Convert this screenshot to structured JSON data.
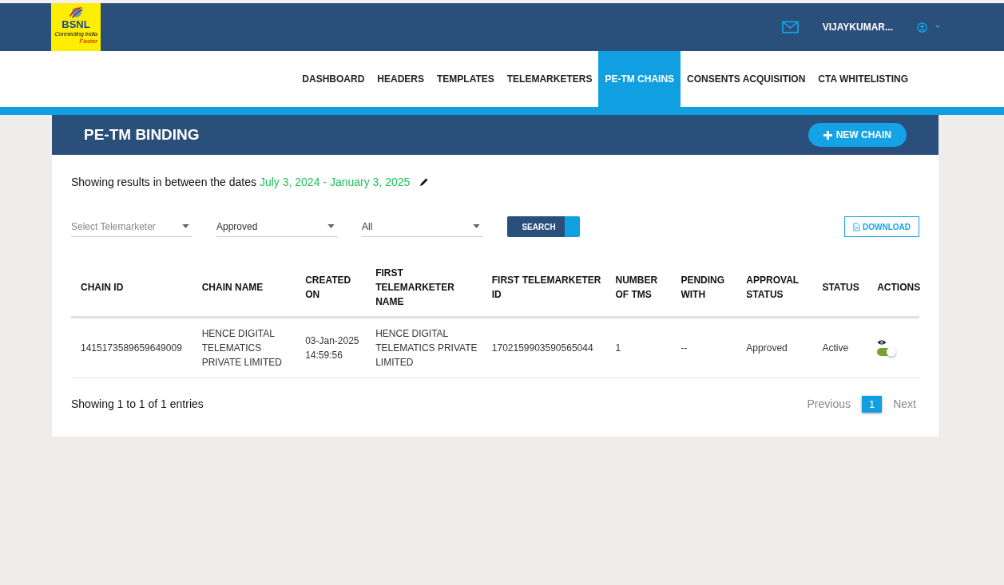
{
  "logo": {
    "name": "BSNL",
    "tagline": "Connecting India",
    "tagline_2": "Faster"
  },
  "user": {
    "name": "VIJAYKUMAR..."
  },
  "nav": [
    {
      "label": "DASHBOARD",
      "selected": false
    },
    {
      "label": "HEADERS",
      "selected": false
    },
    {
      "label": "TEMPLATES",
      "selected": false
    },
    {
      "label": "TELEMARKETERS",
      "selected": false
    },
    {
      "label": "PE-TM CHAINS",
      "selected": true
    },
    {
      "label": "CONSENTS ACQUISITION",
      "selected": false
    },
    {
      "label": "CTA WHITELISTING",
      "selected": false
    }
  ],
  "panel": {
    "title": "PE-TM BINDING",
    "new_button": "NEW CHAIN"
  },
  "date_range": {
    "prefix": "Showing results in between the dates",
    "range": "July 3, 2024 - January 3, 2025"
  },
  "filters": [
    {
      "placeholder": "Select Telemarketer"
    },
    {
      "value": "Approved"
    },
    {
      "value": "All"
    }
  ],
  "search_button": "SEARCH",
  "download_button": "DOWNLOAD",
  "table": {
    "columns": [
      "CHAIN ID",
      "CHAIN NAME",
      "CREATED ON",
      "FIRST TELEMARKETER NAME",
      "FIRST TELEMARKETER ID",
      "NUMBER OF TMS",
      "PENDING WITH",
      "APPROVAL STATUS",
      "STATUS",
      "ACTIONS"
    ],
    "rows": [
      {
        "cells": [
          "1415173589659649009",
          "HENCE DIGITAL TELEMATICS PRIVATE LIMITED",
          "03-Jan-2025 14:59:56",
          "HENCE DIGITAL TELEMATICS PRIVATE LIMITED",
          "1702159903590565044",
          "1",
          "--",
          "Approved",
          "Active"
        ],
        "on": true
      }
    ]
  },
  "summary": "Showing 1 to 1 of 1 entries",
  "pagination": {
    "previous": "Previous",
    "pages": [
      {
        "label": "1",
        "selected": true
      }
    ],
    "next": "Next"
  }
}
